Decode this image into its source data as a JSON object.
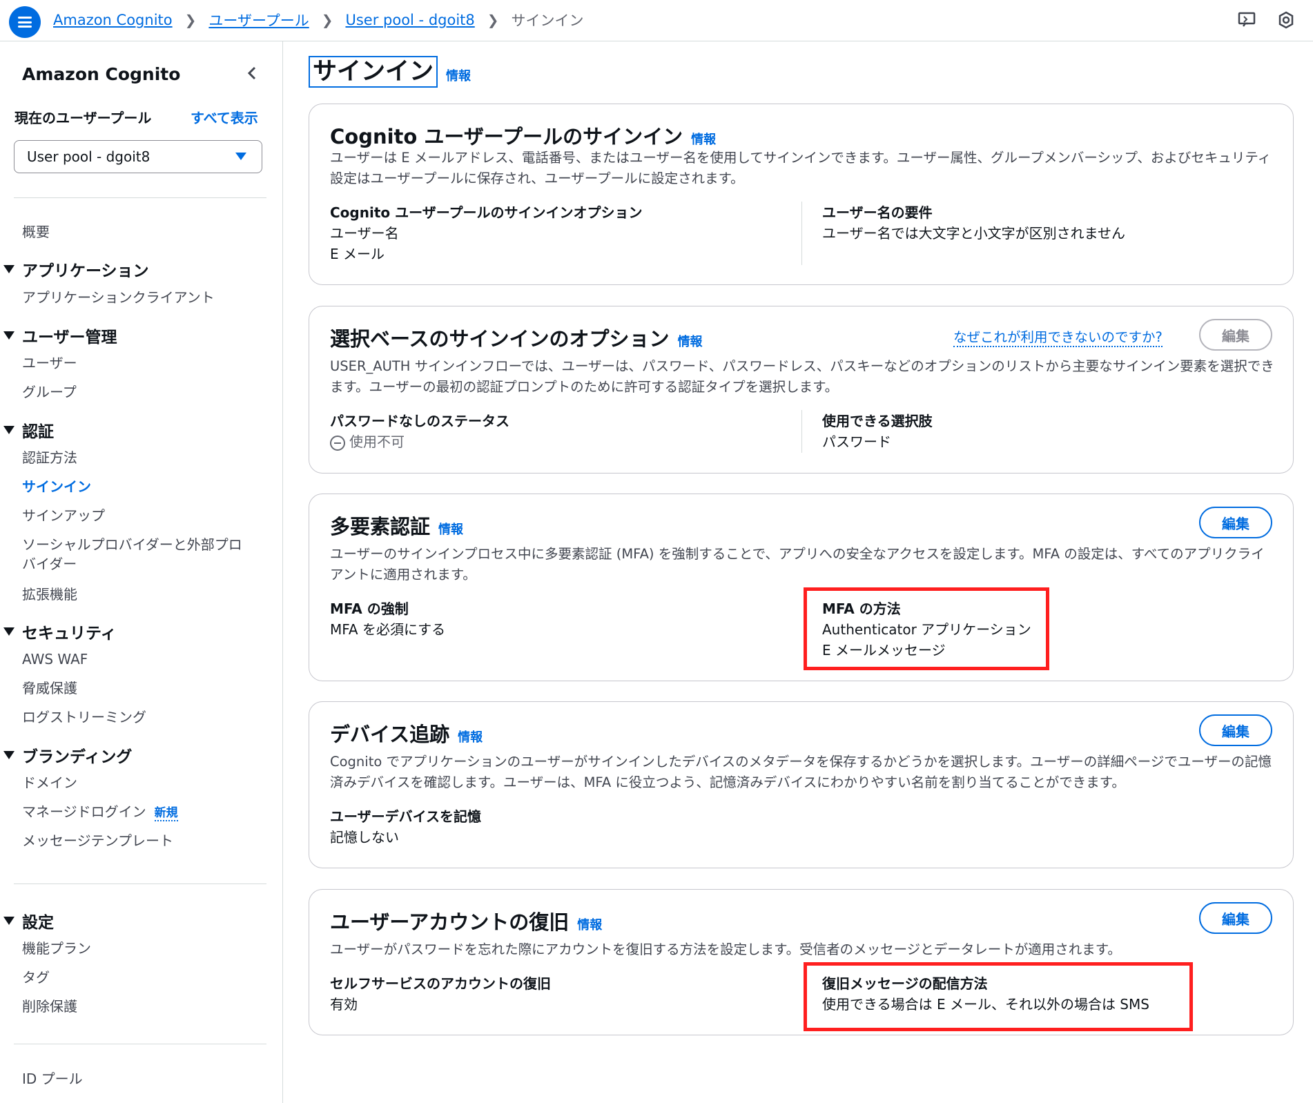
{
  "breadcrumb": [
    "Amazon Cognito",
    "ユーザープール",
    "User pool - dgoit8",
    "サインイン"
  ],
  "sidebar": {
    "title": "Amazon Cognito",
    "pool_label": "現在のユーザープール",
    "show_all": "すべて表示",
    "selected_pool": "User pool - dgoit8",
    "overview": "概要",
    "groups": {
      "applications": "アプリケーション",
      "user_management": "ユーザー管理",
      "authentication": "認証",
      "security": "セキュリティ",
      "branding": "ブランディング",
      "settings": "設定"
    },
    "items": {
      "app_clients": "アプリケーションクライアント",
      "users": "ユーザー",
      "groups": "グループ",
      "auth_methods": "認証方法",
      "sign_in": "サインイン",
      "sign_up": "サインアップ",
      "social_providers_1": "ソーシャルプロバイダーと外部プロ",
      "social_providers_2": "バイダー",
      "extensions": "拡張機能",
      "aws_waf": "AWS WAF",
      "threat_protection": "脅威保護",
      "log_streaming": "ログストリーミング",
      "domain": "ドメイン",
      "managed_login": "マネージドログイン",
      "new_badge": "新規",
      "message_templates": "メッセージテンプレート",
      "feature_plan": "機能プラン",
      "tags": "タグ",
      "deletion_protection": "削除保護",
      "identity_pools": "ID プール"
    }
  },
  "page": {
    "title": "サインイン",
    "info": "情報"
  },
  "cards": {
    "signin": {
      "title": "Cognito ユーザープールのサインイン",
      "info": "情報",
      "desc": "ユーザーは E メールアドレス、電話番号、またはユーザー名を使用してサインインできます。ユーザー属性、グループメンバーシップ、およびセキュリティ設定はユーザープールに保存され、ユーザープールに設定されます。",
      "options_label": "Cognito ユーザープールのサインインオプション",
      "option_1": "ユーザー名",
      "option_2": "E メール",
      "username_req_label": "ユーザー名の要件",
      "username_req_value": "ユーザー名では大文字と小文字が区別されません"
    },
    "choice": {
      "title": "選択ベースのサインインのオプション",
      "info": "情報",
      "why": "なぜこれが利用できないのですか?",
      "edit": "編集",
      "desc": "USER_AUTH サインインフローでは、ユーザーは、パスワード、パスワードレス、パスキーなどのオプションのリストから主要なサインイン要素を選択できます。ユーザーの最初の認証プロンプトのために許可する認証タイプを選択します。",
      "passwordless_label": "パスワードなしのステータス",
      "passwordless_value": "使用不可",
      "available_label": "使用できる選択肢",
      "available_value": "パスワード"
    },
    "mfa": {
      "title": "多要素認証",
      "info": "情報",
      "edit": "編集",
      "desc": "ユーザーのサインインプロセス中に多要素認証 (MFA) を強制することで、アプリへの安全なアクセスを設定します。MFA の設定は、すべてのアプリクライアントに適用されます。",
      "enforcement_label": "MFA の強制",
      "enforcement_value": "MFA を必須にする",
      "methods_label": "MFA の方法",
      "method_1": "Authenticator アプリケーション",
      "method_2": "E メールメッセージ"
    },
    "device": {
      "title": "デバイス追跡",
      "info": "情報",
      "edit": "編集",
      "desc": "Cognito でアプリケーションのユーザーがサインインしたデバイスのメタデータを保存するかどうかを選択します。ユーザーの詳細ページでユーザーの記憶済みデバイスを確認します。ユーザーは、MFA に役立つよう、記憶済みデバイスにわかりやすい名前を割り当てることができます。",
      "remember_label": "ユーザーデバイスを記憶",
      "remember_value": "記憶しない"
    },
    "recovery": {
      "title": "ユーザーアカウントの復旧",
      "info": "情報",
      "edit": "編集",
      "desc": "ユーザーがパスワードを忘れた際にアカウントを復旧する方法を設定します。受信者のメッセージとデータレートが適用されます。",
      "self_service_label": "セルフサービスのアカウントの復旧",
      "self_service_value": "有効",
      "delivery_label": "復旧メッセージの配信方法",
      "delivery_value": "使用できる場合は E メール、それ以外の場合は SMS"
    }
  },
  "colors": {
    "accent": "#006ce0",
    "highlight": "#ff1f1f",
    "border": "#c6c6cd"
  }
}
